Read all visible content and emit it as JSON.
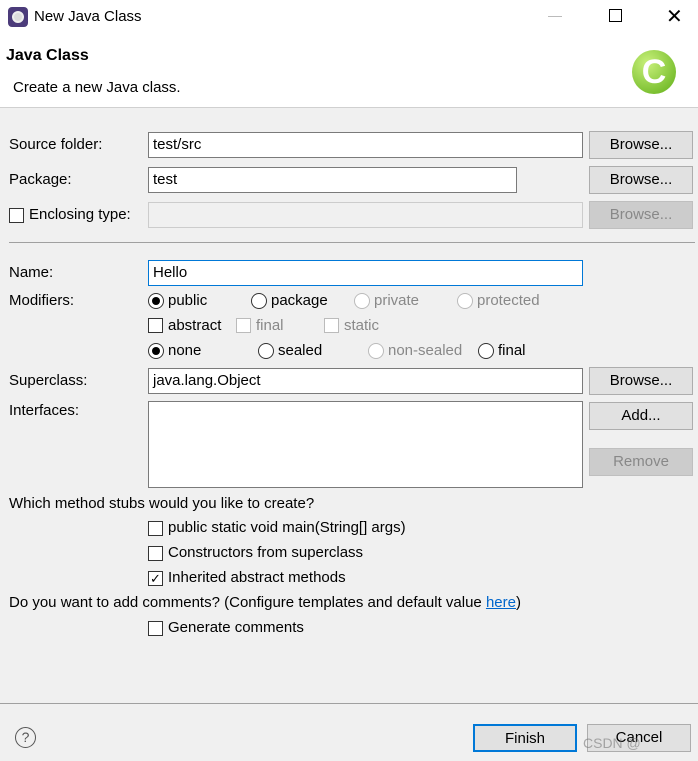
{
  "window": {
    "title": "New Java Class",
    "icon": "eclipse-icon"
  },
  "header": {
    "title": "Java Class",
    "subtitle": "Create a new Java class.",
    "icon": "java-class-c-icon"
  },
  "source_folder": {
    "label": "Source folder:",
    "value": "test/src",
    "browse": "Browse..."
  },
  "package": {
    "label": "Package:",
    "value": "test",
    "browse": "Browse..."
  },
  "enclosing": {
    "label": "Enclosing type:",
    "value": "",
    "checked": false,
    "browse": "Browse..."
  },
  "name": {
    "label": "Name:",
    "value": "Hello"
  },
  "modifiers": {
    "label": "Modifiers:",
    "access": [
      "public",
      "package",
      "private",
      "protected"
    ],
    "access_selected": "public",
    "abstract": "abstract",
    "final": "final",
    "static": "static",
    "sealing": [
      "none",
      "sealed",
      "non-sealed",
      "final"
    ],
    "sealing_selected": "none"
  },
  "superclass": {
    "label": "Superclass:",
    "value": "java.lang.Object",
    "browse": "Browse..."
  },
  "interfaces": {
    "label": "Interfaces:",
    "add": "Add...",
    "remove": "Remove"
  },
  "stubs": {
    "question": "Which method stubs would you like to create?",
    "items": [
      {
        "label": "public static void main(String[] args)",
        "checked": false
      },
      {
        "label": "Constructors from superclass",
        "checked": false
      },
      {
        "label": "Inherited abstract methods",
        "checked": true
      }
    ]
  },
  "comments": {
    "question": "Do you want to add comments? (Configure templates and default value ",
    "link": "here",
    "close": ")",
    "generate": "Generate comments",
    "checked": false
  },
  "footer": {
    "finish": "Finish",
    "cancel": "Cancel",
    "watermark": "CSDN @"
  }
}
